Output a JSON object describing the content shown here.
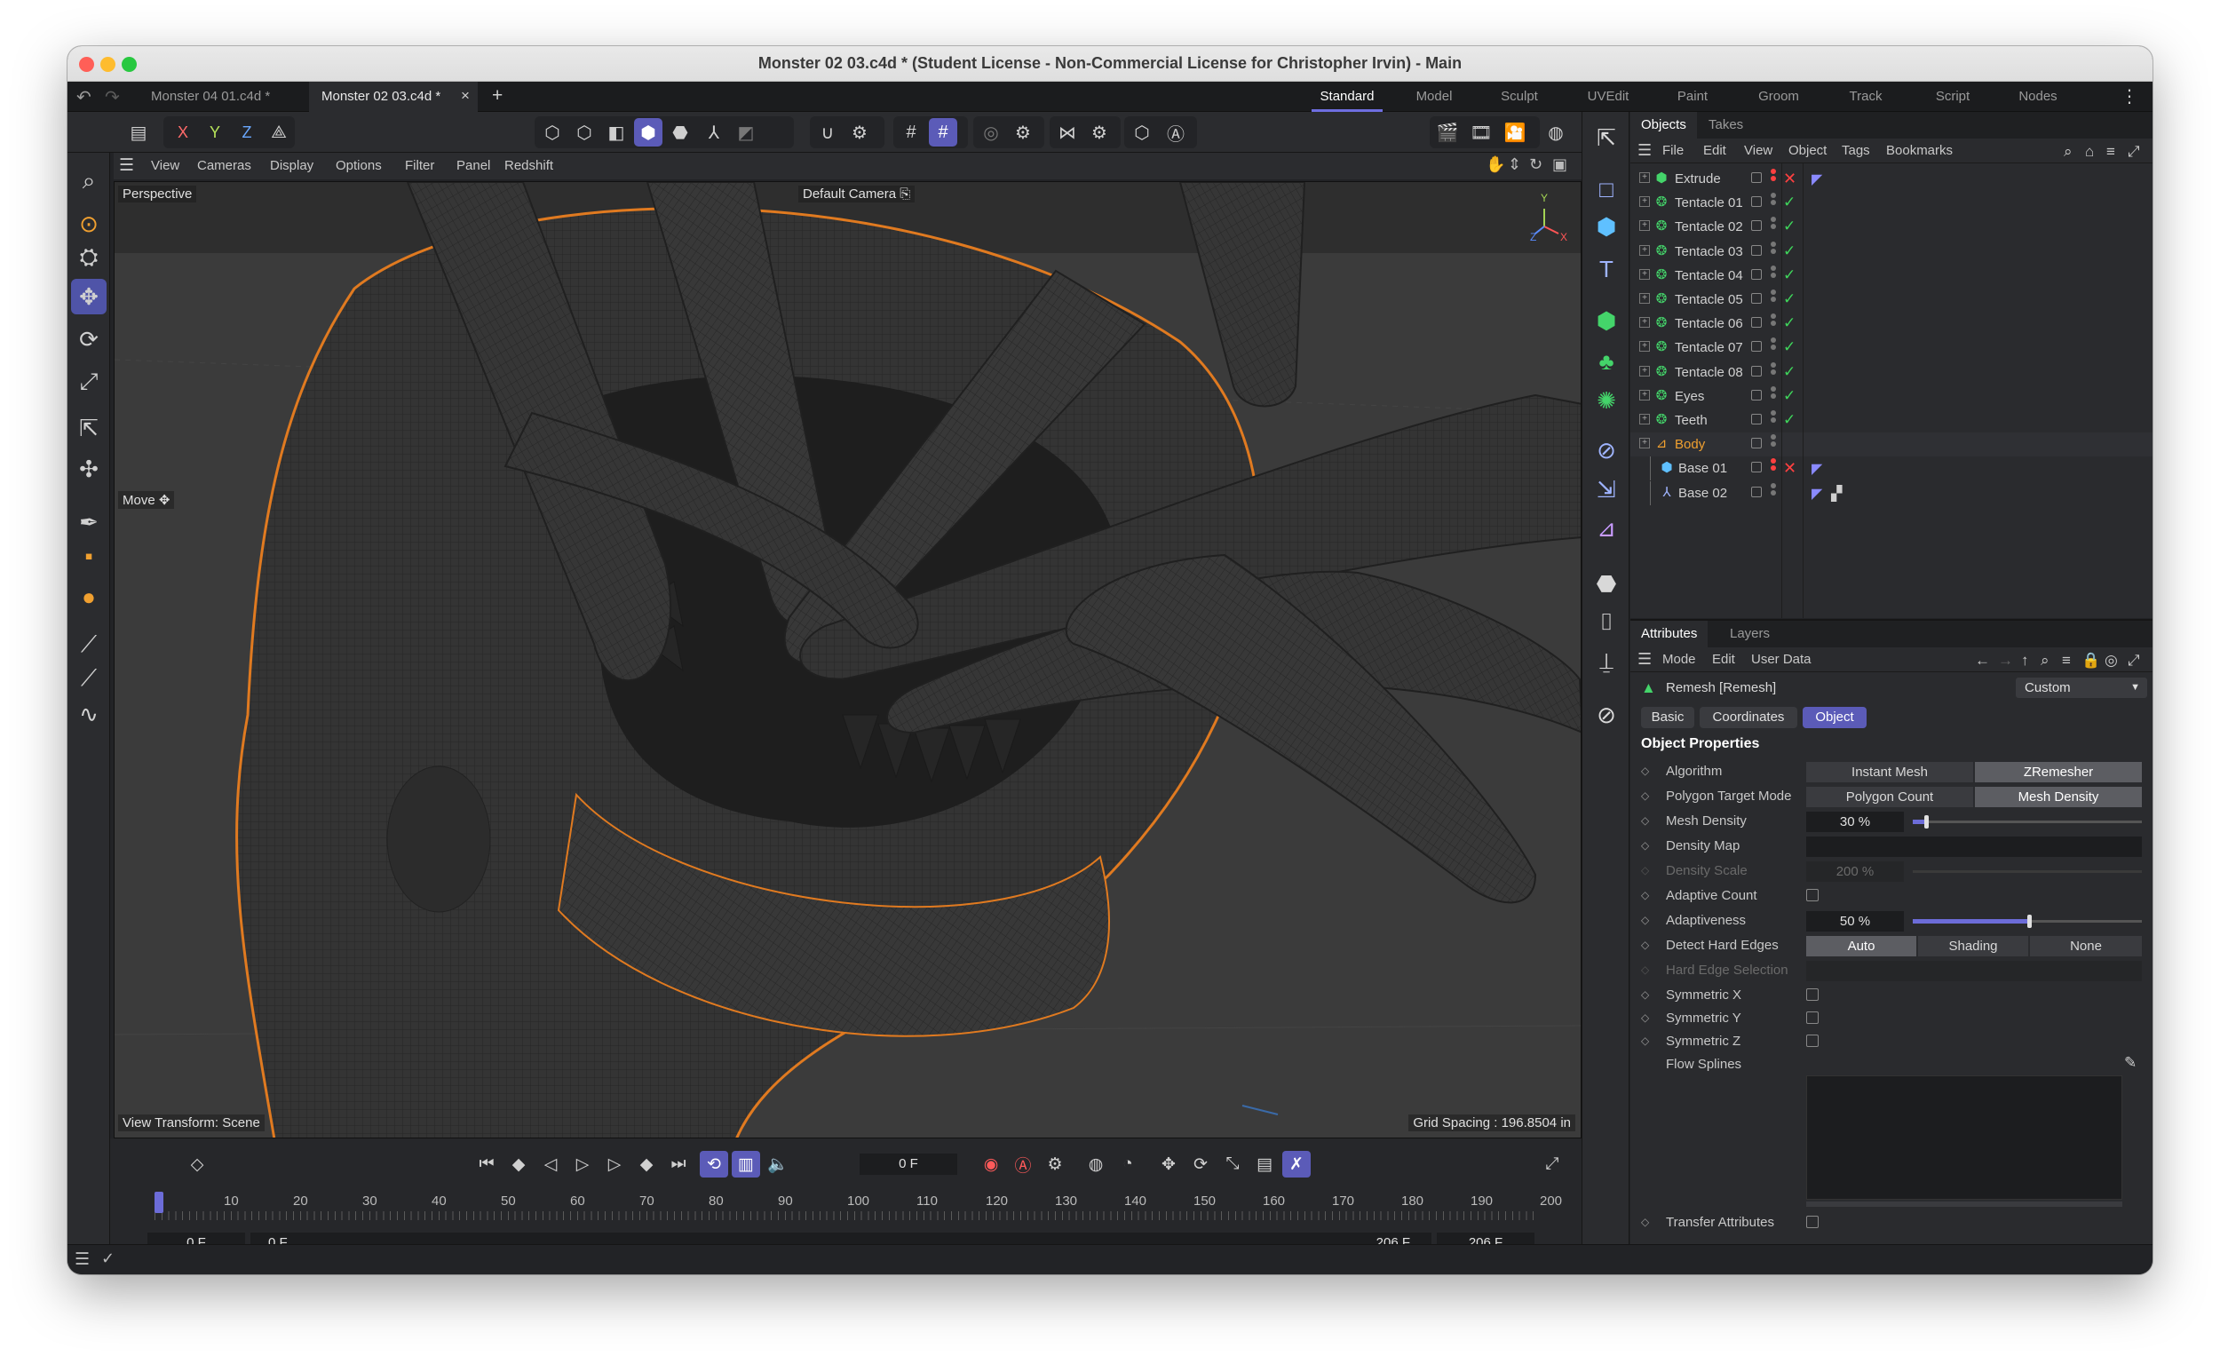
{
  "window": {
    "title": "Monster 02 03.c4d * (Student License - Non-Commercial License for Christopher Irvin) - Main",
    "traffic_colors": [
      "#ff5f57",
      "#febc2e",
      "#28c840"
    ]
  },
  "doc_tabs": [
    {
      "label": "Monster 04 01.c4d *"
    },
    {
      "label": "Monster 02 03.c4d *"
    }
  ],
  "add_tab_label": "+",
  "close_tab_label": "×",
  "workspaces": [
    {
      "label": "Standard"
    },
    {
      "label": "Model"
    },
    {
      "label": "Sculpt"
    },
    {
      "label": "UVEdit"
    },
    {
      "label": "Paint"
    },
    {
      "label": "Groom"
    },
    {
      "label": "Track"
    },
    {
      "label": "Script"
    },
    {
      "label": "Nodes"
    }
  ],
  "axis_lock": {
    "x": "X",
    "y": "Y",
    "z": "Z"
  },
  "viewport": {
    "menu": [
      "View",
      "Cameras",
      "Display",
      "Options",
      "Filter",
      "Panel",
      "Redshift"
    ],
    "view_name": "Perspective",
    "camera": "Default Camera",
    "tool_label": "Move",
    "view_transform": "View Transform: Scene",
    "grid_spacing": "Grid Spacing : 196.8504 in",
    "axis_y": "Y",
    "axis_z": "Z",
    "axis_x": "X"
  },
  "objects_panel": {
    "tabs": [
      "Objects",
      "Takes"
    ],
    "menu": [
      "File",
      "Edit",
      "View",
      "Object",
      "Tags",
      "Bookmarks"
    ],
    "rows": [
      {
        "name": "Extrude",
        "icon": "extrude-icon",
        "color": "#d0d0d0"
      },
      {
        "name": "Tentacle 01",
        "icon": "cloner-icon",
        "color": "#d0d0d0"
      },
      {
        "name": "Tentacle 02",
        "icon": "cloner-icon",
        "color": "#d0d0d0"
      },
      {
        "name": "Tentacle 03",
        "icon": "cloner-icon",
        "color": "#d0d0d0"
      },
      {
        "name": "Tentacle 04",
        "icon": "cloner-icon",
        "color": "#d0d0d0"
      },
      {
        "name": "Tentacle 05",
        "icon": "cloner-icon",
        "color": "#d0d0d0"
      },
      {
        "name": "Tentacle 06",
        "icon": "cloner-icon",
        "color": "#d0d0d0"
      },
      {
        "name": "Tentacle 07",
        "icon": "cloner-icon",
        "color": "#d0d0d0"
      },
      {
        "name": "Tentacle 08",
        "icon": "cloner-icon",
        "color": "#d0d0d0"
      },
      {
        "name": "Eyes",
        "icon": "cloner-icon",
        "color": "#d0d0d0"
      },
      {
        "name": "Teeth",
        "icon": "cloner-icon",
        "color": "#d0d0d0"
      },
      {
        "name": "Body",
        "icon": "remesh-icon",
        "color": "#f0a030"
      },
      {
        "name": "Base 01",
        "icon": "cube-icon",
        "color": "#d0d0d0"
      },
      {
        "name": "Base 02",
        "icon": "null-icon",
        "color": "#d0d0d0"
      }
    ]
  },
  "attributes_panel": {
    "tabs": [
      "Attributes",
      "Layers"
    ],
    "menu": [
      "Mode",
      "Edit",
      "User Data"
    ],
    "object_title": "Remesh [Remesh]",
    "preset": "Custom",
    "subtabs": [
      "Basic",
      "Coordinates",
      "Object"
    ],
    "section_title": "Object Properties",
    "algorithm": {
      "label": "Algorithm",
      "options": [
        "Instant Mesh",
        "ZRemesher"
      ],
      "selected": "ZRemesher"
    },
    "polygon_target_mode": {
      "label": "Polygon Target Mode",
      "options": [
        "Polygon Count",
        "Mesh Density"
      ],
      "selected": "Mesh Density"
    },
    "mesh_density": {
      "label": "Mesh Density",
      "value": "30 %",
      "fraction": 0.05
    },
    "density_map": {
      "label": "Density Map"
    },
    "density_scale": {
      "label": "Density Scale",
      "value": "200 %"
    },
    "adaptive_count": {
      "label": "Adaptive Count"
    },
    "adaptiveness": {
      "label": "Adaptiveness",
      "value": "50 %",
      "fraction": 0.5
    },
    "detect_hard_edges": {
      "label": "Detect Hard Edges",
      "options": [
        "Auto",
        "Shading",
        "None"
      ],
      "selected": "Auto"
    },
    "hard_edge_selection": {
      "label": "Hard Edge Selection"
    },
    "symmetric_x": {
      "label": "Symmetric X"
    },
    "symmetric_y": {
      "label": "Symmetric Y"
    },
    "symmetric_z": {
      "label": "Symmetric Z"
    },
    "flow_splines": {
      "label": "Flow Splines"
    },
    "transfer_attributes": {
      "label": "Transfer Attributes"
    }
  },
  "timeline": {
    "current_frame": "0 F",
    "ticks": [
      "0",
      "10",
      "20",
      "30",
      "40",
      "50",
      "60",
      "70",
      "80",
      "90",
      "100",
      "110",
      "120",
      "130",
      "140",
      "150",
      "160",
      "170",
      "180",
      "190",
      "200"
    ],
    "start_field": "0 F",
    "start_field2": "0 F",
    "end_field": "206 F",
    "end_field2": "206 F"
  },
  "colors": {
    "accent": "#5b5bb8",
    "selection_outline": "#e07a20",
    "check_green": "#3fd65b"
  }
}
